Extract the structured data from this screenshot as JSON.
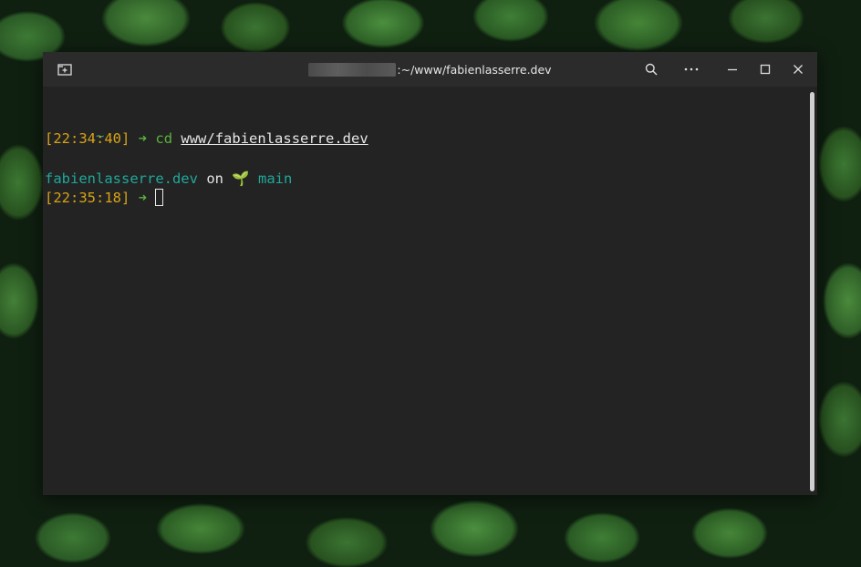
{
  "window": {
    "title_path": ":~/www/fabienlasserre.dev"
  },
  "titlebar": {
    "icons": [
      "new-tab-icon",
      "search-icon",
      "menu-icon",
      "minimize-icon",
      "maximize-icon",
      "close-icon"
    ]
  },
  "terminal": {
    "lines": {
      "l1_tilde": "~",
      "l2_time": "[22:34:40]",
      "l2_arrow": "➜",
      "l2_cmd": "cd",
      "l2_arg": "www/fabienlasserre.dev",
      "l3_dir": "fabienlasserre.dev",
      "l3_on": "on",
      "l3_branch_icon": "🌱",
      "l3_branch": "main",
      "l4_time": "[22:35:18]",
      "l4_arrow": "➜"
    }
  },
  "colors": {
    "timestamp": "#d8a316",
    "arrow": "#58b33a",
    "directory": "#1fa99a",
    "background": "#232323",
    "titlebar": "#2b2b2b"
  }
}
